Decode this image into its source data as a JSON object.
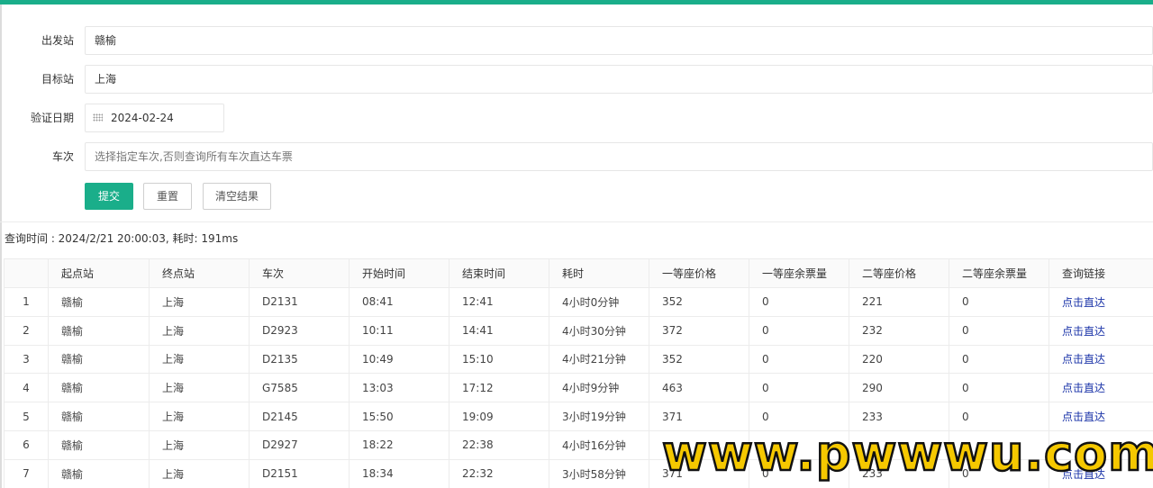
{
  "form": {
    "departure": {
      "label": "出发站",
      "value": "赣榆"
    },
    "destination": {
      "label": "目标站",
      "value": "上海"
    },
    "date": {
      "label": "验证日期",
      "value": "2024-02-24"
    },
    "train": {
      "label": "车次",
      "placeholder": "选择指定车次,否则查询所有车次直达车票"
    }
  },
  "buttons": {
    "submit": "提交",
    "reset": "重置",
    "clear": "清空结果"
  },
  "query_info": "查询时间 : 2024/2/21 20:00:03, 耗时: 191ms",
  "table": {
    "headers": [
      "",
      "起点站",
      "终点站",
      "车次",
      "开始时间",
      "结束时间",
      "耗时",
      "一等座价格",
      "一等座余票量",
      "二等座价格",
      "二等座余票量",
      "查询链接"
    ],
    "rows": [
      [
        "1",
        "赣榆",
        "上海",
        "D2131",
        "08:41",
        "12:41",
        "4小时0分钟",
        "352",
        "0",
        "221",
        "0",
        "点击直达"
      ],
      [
        "2",
        "赣榆",
        "上海",
        "D2923",
        "10:11",
        "14:41",
        "4小时30分钟",
        "372",
        "0",
        "232",
        "0",
        "点击直达"
      ],
      [
        "3",
        "赣榆",
        "上海",
        "D2135",
        "10:49",
        "15:10",
        "4小时21分钟",
        "352",
        "0",
        "220",
        "0",
        "点击直达"
      ],
      [
        "4",
        "赣榆",
        "上海",
        "G7585",
        "13:03",
        "17:12",
        "4小时9分钟",
        "463",
        "0",
        "290",
        "0",
        "点击直达"
      ],
      [
        "5",
        "赣榆",
        "上海",
        "D2145",
        "15:50",
        "19:09",
        "3小时19分钟",
        "371",
        "0",
        "233",
        "0",
        "点击直达"
      ],
      [
        "6",
        "赣榆",
        "上海",
        "D2927",
        "18:22",
        "22:38",
        "4小时16分钟",
        "",
        "",
        "",
        "",
        ""
      ],
      [
        "7",
        "赣榆",
        "上海",
        "D2151",
        "18:34",
        "22:32",
        "3小时58分钟",
        "371",
        "0",
        "233",
        "0",
        "点击直达"
      ]
    ]
  },
  "watermark": "www.pwwwu.com",
  "colors": {
    "accent": "#1aae8a",
    "link": "#1a33a8",
    "watermark": "#f5c800"
  }
}
